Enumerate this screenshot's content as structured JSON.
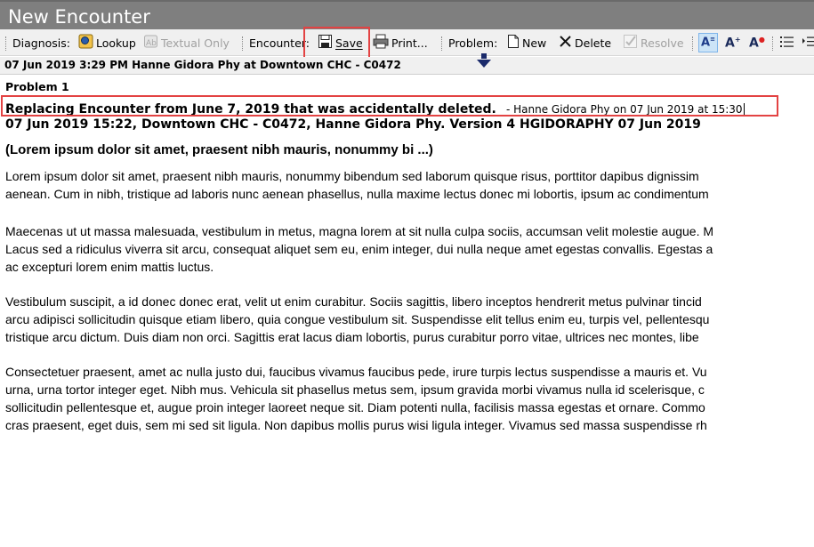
{
  "window": {
    "title": "New Encounter"
  },
  "toolbar": {
    "diagnosis_label": "Diagnosis:",
    "lookup_label": "Lookup",
    "textual_only_label": "Textual Only",
    "encounter_label": "Encounter:",
    "save_label": "Save",
    "print_label": "Print...",
    "problem_label": "Problem:",
    "new_label": "New",
    "delete_label": "Delete",
    "resolve_label": "Resolve"
  },
  "encounter_header": "07 Jun 2019 3:29 PM Hanne Gidora Phy at Downtown CHC - C0472",
  "document": {
    "problem_heading": "Problem 1",
    "replacement_note": "Replacing Encounter from June 7, 2019 that was accidentally deleted.",
    "replacement_byline": "- Hanne Gidora Phy on 07 Jun 2019 at 15:30",
    "version_line": "07 Jun 2019 15:22, Downtown CHC - C0472, Hanne Gidora Phy.  Version 4 HGIDORAPHY 07 Jun 2019",
    "subject": "(Lorem ipsum dolor sit amet, praesent nibh mauris, nonummy bi ...)",
    "paragraphs": [
      [
        "Lorem ipsum dolor sit amet, praesent nibh mauris, nonummy bibendum sed laborum quisque risus, porttitor dapibus dignissim",
        "aenean. Cum in nibh, tristique ad laboris nunc aenean phasellus, nulla maxime lectus donec mi lobortis, ipsum ac condimentum"
      ],
      [
        "Maecenas ut ut massa malesuada, vestibulum in metus, magna lorem at sit nulla culpa sociis, accumsan velit molestie augue. M",
        "Lacus sed a ridiculus viverra sit arcu, consequat aliquet sem eu, enim integer, dui nulla neque amet egestas convallis. Egestas a",
        "ac excepturi lorem enim mattis luctus."
      ],
      [
        "Vestibulum suscipit, a id donec donec erat, velit ut enim curabitur. Sociis sagittis, libero inceptos hendrerit metus pulvinar tincid",
        "arcu adipisci sollicitudin quisque etiam libero, quia congue vestibulum sit. Suspendisse elit tellus enim eu, turpis vel, pellentesqu",
        "tristique arcu dictum. Duis diam non orci. Sagittis erat lacus diam lobortis, purus curabitur porro vitae, ultrices nec montes, libe"
      ],
      [
        "Consectetuer praesent, amet ac nulla justo dui, faucibus vivamus faucibus pede, irure turpis lectus suspendisse a mauris et. Vu",
        "urna, urna tortor integer eget. Nibh mus. Vehicula sit phasellus metus sem, ipsum gravida morbi vivamus nulla id scelerisque, c",
        "sollicitudin pellentesque et, augue proin integer laoreet neque sit. Diam potenti nulla, facilisis massa egestas et ornare. Commo",
        "cras praesent, eget duis, sem mi sed sit ligula. Non dapibus mollis purus wisi ligula integer. Vivamus sed massa suspendisse rh"
      ]
    ]
  },
  "colors": {
    "highlight": "#e34343",
    "title_bar": "#7f7f7f",
    "arrow": "#1a2a6b"
  }
}
